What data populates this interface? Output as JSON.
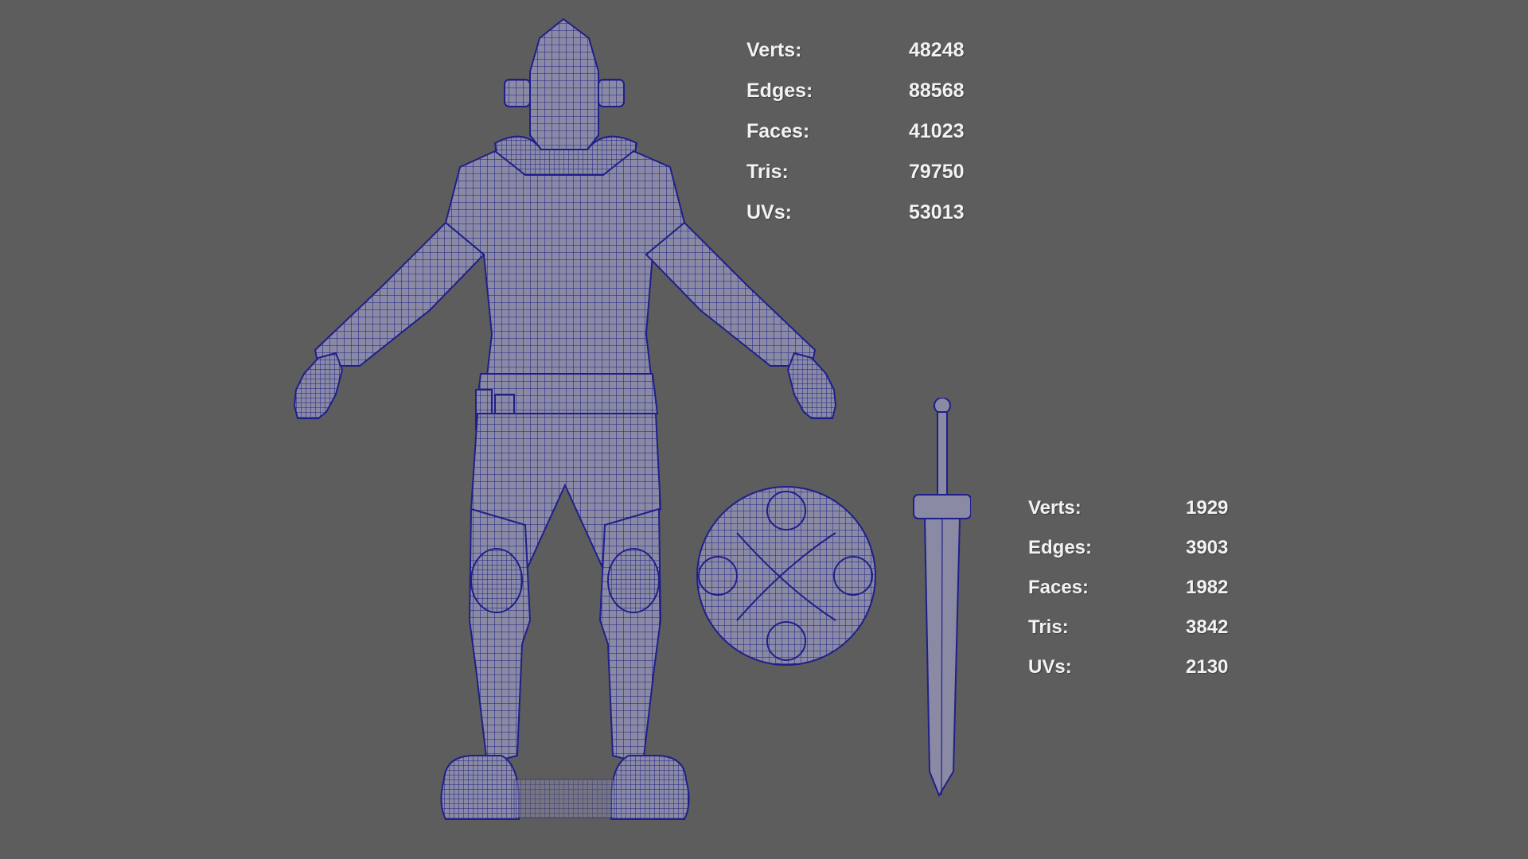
{
  "viewport": {
    "background": "#5d5d5d",
    "wire_color": "#1f1f8a",
    "surface_color": "#8a8aa4"
  },
  "character_stats": [
    {
      "label": "Verts:",
      "value": "48248"
    },
    {
      "label": "Edges:",
      "value": "88568"
    },
    {
      "label": "Faces:",
      "value": "41023"
    },
    {
      "label": "Tris:",
      "value": "79750"
    },
    {
      "label": "UVs:",
      "value": "53013"
    }
  ],
  "props_stats": [
    {
      "label": "Verts:",
      "value": "1929"
    },
    {
      "label": "Edges:",
      "value": "3903"
    },
    {
      "label": "Faces:",
      "value": "1982"
    },
    {
      "label": "Tris:",
      "value": "3842"
    },
    {
      "label": "UVs:",
      "value": "2130"
    }
  ]
}
